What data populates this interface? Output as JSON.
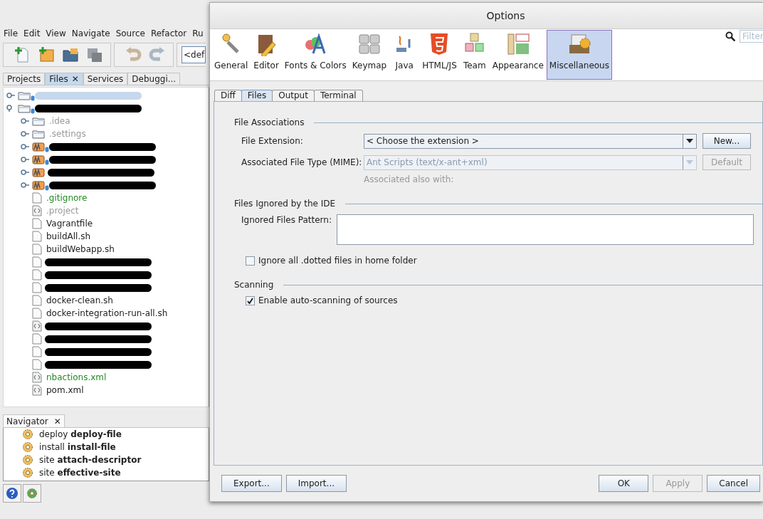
{
  "ide": {
    "menu": [
      "File",
      "Edit",
      "View",
      "Navigate",
      "Source",
      "Refactor",
      "Ru"
    ],
    "config_combo": "<def",
    "tabs": [
      {
        "label": "Projects",
        "selected": false
      },
      {
        "label": "Files",
        "selected": true,
        "close": "✕"
      },
      {
        "label": "Services",
        "selected": false
      },
      {
        "label": "Debuggi...",
        "selected": false
      }
    ],
    "tree": [
      {
        "kind": "project",
        "expanded": false,
        "selected": true
      },
      {
        "kind": "project",
        "expanded": true,
        "selected": false,
        "children": [
          {
            "kind": "folder",
            "label": ".idea",
            "color": "#999999",
            "expanded": false
          },
          {
            "kind": "folder",
            "label": ".settings",
            "color": "#999999",
            "expanded": false
          },
          {
            "kind": "module",
            "expanded": false
          },
          {
            "kind": "module",
            "expanded": false
          },
          {
            "kind": "maven",
            "expanded": false
          },
          {
            "kind": "module",
            "expanded": false
          },
          {
            "kind": "file",
            "label": ".gitignore",
            "color": "#228b22"
          },
          {
            "kind": "xml",
            "label": ".project",
            "color": "#999999"
          },
          {
            "kind": "file",
            "label": "Vagrantfile"
          },
          {
            "kind": "file",
            "label": "buildAll.sh"
          },
          {
            "kind": "file",
            "label": "buildWebapp.sh"
          },
          {
            "kind": "file"
          },
          {
            "kind": "file"
          },
          {
            "kind": "file"
          },
          {
            "kind": "file",
            "label": "docker-clean.sh"
          },
          {
            "kind": "file",
            "label": "docker-integration-run-all.sh"
          },
          {
            "kind": "xml"
          },
          {
            "kind": "file"
          },
          {
            "kind": "file"
          },
          {
            "kind": "file"
          },
          {
            "kind": "xml",
            "label": "nbactions.xml",
            "color": "#228b22"
          },
          {
            "kind": "xml",
            "label": "pom.xml"
          }
        ]
      }
    ],
    "navigator": {
      "title": "Navigator",
      "close": "✕",
      "items": [
        "deploy **deploy-file**",
        "install **install-file**",
        "site **attach-descriptor**",
        "site **effective-site**"
      ]
    }
  },
  "dialog": {
    "title": "Options",
    "filter": {
      "placeholder": "Filter"
    },
    "categories": [
      {
        "label": "General",
        "selected": false
      },
      {
        "label": "Editor",
        "selected": false
      },
      {
        "label": "Fonts & Colors",
        "selected": false
      },
      {
        "label": "Keymap",
        "selected": false
      },
      {
        "label": "Java",
        "selected": false
      },
      {
        "label": "HTML/JS",
        "selected": false
      },
      {
        "label": "Team",
        "selected": false
      },
      {
        "label": "Appearance",
        "selected": false
      },
      {
        "label": "Miscellaneous",
        "selected": true
      }
    ],
    "tabs": [
      {
        "label": "Diff",
        "selected": false
      },
      {
        "label": "Files",
        "selected": true
      },
      {
        "label": "Output",
        "selected": false
      },
      {
        "label": "Terminal",
        "selected": false
      }
    ],
    "file_associations": {
      "heading": "File Associations",
      "extension_label": "File Extension:",
      "extension_value": "< Choose the extension >",
      "new_button": "New...",
      "mime_label": "Associated File Type (MIME):",
      "mime_value": "Ant Scripts (text/x-ant+xml)",
      "mime_disabled": true,
      "default_button": "Default",
      "default_disabled": true,
      "also_with": "Associated also with:"
    },
    "ignored": {
      "heading": "Files Ignored by the IDE",
      "pattern_label": "Ignored Files Pattern:",
      "dotted_label": "Ignore all .dotted files in home folder",
      "dotted_checked": false
    },
    "scanning": {
      "heading": "Scanning",
      "auto_label": "Enable auto-scanning of sources",
      "auto_checked": true
    },
    "buttons_left": [
      {
        "label": "Export...",
        "disabled": false
      },
      {
        "label": "Import...",
        "disabled": false
      }
    ],
    "buttons_right": [
      {
        "label": "OK",
        "disabled": false
      },
      {
        "label": "Apply",
        "disabled": true
      },
      {
        "label": "Cancel",
        "disabled": false
      }
    ]
  }
}
